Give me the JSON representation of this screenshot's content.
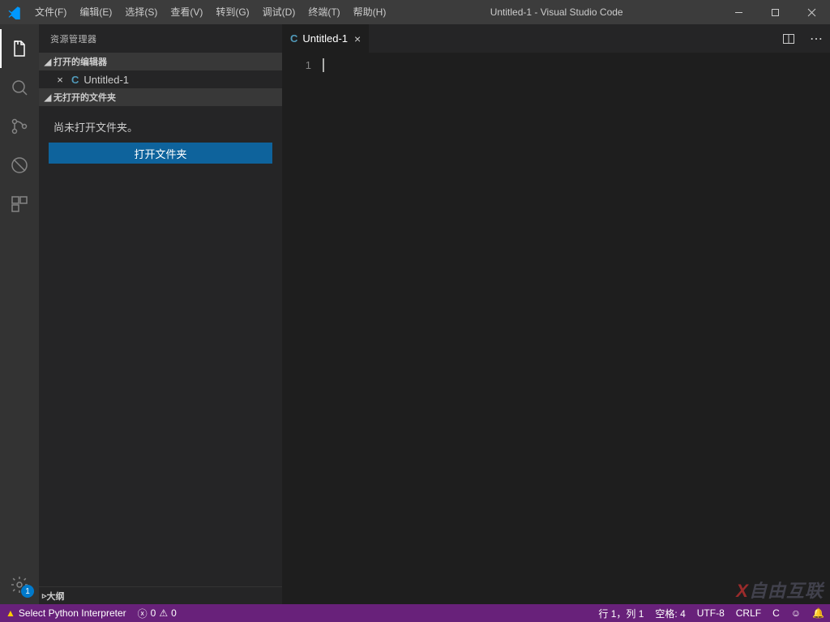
{
  "window": {
    "title": "Untitled-1 - Visual Studio Code"
  },
  "menu": {
    "file": "文件(F)",
    "edit": "编辑(E)",
    "select": "选择(S)",
    "view": "查看(V)",
    "goto": "转到(G)",
    "debug": "调试(D)",
    "terminal": "终端(T)",
    "help": "帮助(H)"
  },
  "activity": {
    "settings_badge": "1"
  },
  "sidebar": {
    "title": "资源管理器",
    "open_editors": "打开的编辑器",
    "file": "Untitled-1",
    "no_folder": "无打开的文件夹",
    "msg": "尚未打开文件夹。",
    "open_btn": "打开文件夹",
    "outline": "大纲"
  },
  "tab": {
    "label": "Untitled-1",
    "lang_icon": "C"
  },
  "editor": {
    "line1": "1"
  },
  "status": {
    "interpreter": "Select Python Interpreter",
    "errors": "0",
    "warnings": "0",
    "ln_col": "行 1，列 1",
    "spaces": "空格: 4",
    "encoding": "UTF-8",
    "eol": "CRLF",
    "lang": "C"
  },
  "watermark": "自由互联"
}
